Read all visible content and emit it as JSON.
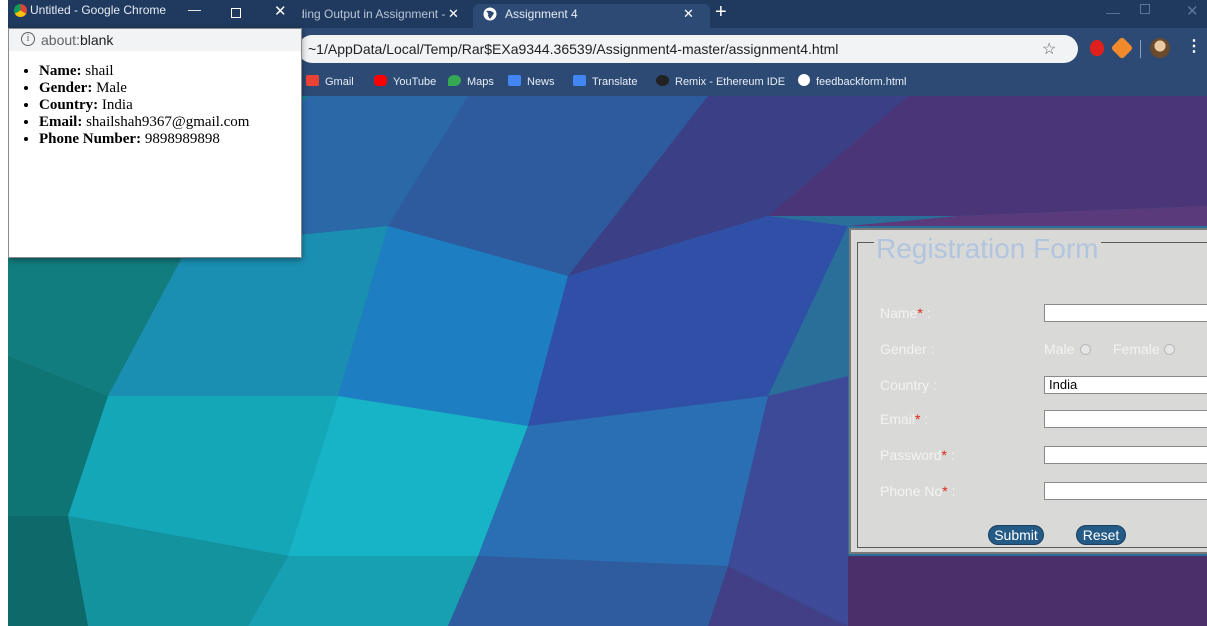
{
  "window": {
    "title": "Untitled - Google Chrome"
  },
  "tabs": [
    {
      "label": "ding Output in Assignment - "
    },
    {
      "label": "Assignment 4"
    }
  ],
  "address_bar": {
    "url": "~1/AppData/Local/Temp/Rar$EXa9344.36539/Assignment4-master/assignment4.html"
  },
  "bookmarks": [
    {
      "label": "Gmail",
      "icon": "gmail-icon",
      "color": "#ea4335"
    },
    {
      "label": "YouTube",
      "icon": "youtube-icon",
      "color": "#ff0000"
    },
    {
      "label": "Maps",
      "icon": "maps-icon",
      "color": "#34a853"
    },
    {
      "label": "News",
      "icon": "news-icon",
      "color": "#4285f4"
    },
    {
      "label": "Translate",
      "icon": "translate-icon",
      "color": "#4285f4"
    },
    {
      "label": "Remix - Ethereum IDE",
      "icon": "remix-icon",
      "color": "#222222"
    },
    {
      "label": "feedbackform.html",
      "icon": "globe-icon",
      "color": "#ffffff"
    }
  ],
  "popup": {
    "url_scheme": "about:",
    "url_path": "blank",
    "entries": [
      {
        "key": "Name:",
        "value": "shail"
      },
      {
        "key": "Gender:",
        "value": "Male"
      },
      {
        "key": "Country:",
        "value": "India"
      },
      {
        "key": "Email:",
        "value": "shailshah9367@gmail.com"
      },
      {
        "key": "Phone Number:",
        "value": "9898989898"
      }
    ]
  },
  "form": {
    "legend": "Registration Form",
    "name_label": "Name",
    "gender_label": "Gender :",
    "male_label": "Male",
    "female_label": "Female",
    "country_label": "Country :",
    "country_value": "India",
    "email_label": "Email",
    "password_label": "Password",
    "phone_label": "Phone No",
    "required_mark": "*",
    "colon": " :",
    "submit_label": "Submit",
    "reset_label": "Reset"
  },
  "colors": {
    "chrome_frame": "#1f3a5e",
    "toolbar": "#2c4a74",
    "form_bg": "#d9d9d7",
    "legend": "#b1c5df",
    "button": "#245a86",
    "required": "#e2231a"
  }
}
